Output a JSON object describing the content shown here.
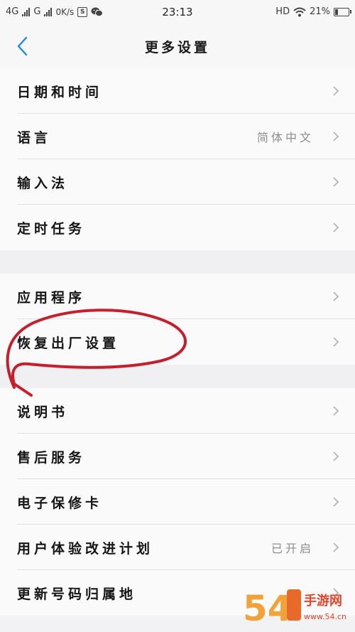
{
  "status_bar": {
    "network_1": "4G",
    "network_2": "G",
    "speed": "0K/s",
    "time": "23:13",
    "hd": "HD",
    "battery": "21%",
    "battery_level": 0.21
  },
  "header": {
    "title": "更多设置"
  },
  "groups": [
    {
      "items": [
        {
          "label": "日期和时间",
          "value": ""
        },
        {
          "label": "语言",
          "value": "简体中文"
        },
        {
          "label": "输入法",
          "value": ""
        },
        {
          "label": "定时任务",
          "value": ""
        }
      ]
    },
    {
      "items": [
        {
          "label": "应用程序",
          "value": ""
        },
        {
          "label": "恢复出厂设置",
          "value": ""
        }
      ]
    },
    {
      "items": [
        {
          "label": "说明书",
          "value": ""
        },
        {
          "label": "售后服务",
          "value": ""
        },
        {
          "label": "电子保修卡",
          "value": ""
        },
        {
          "label": "用户体验改进计划",
          "value": "已开启"
        },
        {
          "label": "更新号码归属地",
          "value": ""
        }
      ]
    }
  ],
  "watermark": {
    "number": "54",
    "logo_text": "手游网",
    "domain": "www.54.cn"
  },
  "colors": {
    "accent": "#1e88e5",
    "annotation": "#c41f2c"
  }
}
